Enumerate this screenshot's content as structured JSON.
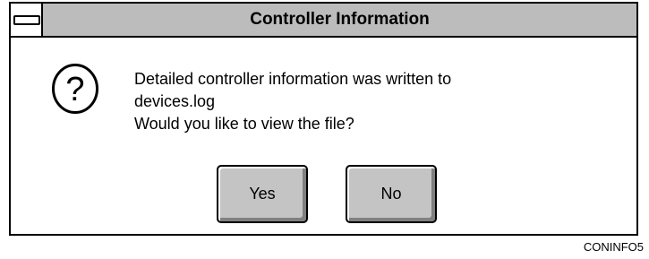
{
  "dialog": {
    "title": "Controller Information",
    "icon": "question-mark-icon",
    "message_lines": [
      "Detailed controller information was written to",
      "devices.log",
      "Would you like to view the file?"
    ],
    "buttons": {
      "yes_label": "Yes",
      "no_label": "No"
    }
  },
  "figure_label": "CONINFO5",
  "colors": {
    "titlebar": "#bcbcbc",
    "button_face": "#c4c4c4",
    "border": "#000000"
  }
}
